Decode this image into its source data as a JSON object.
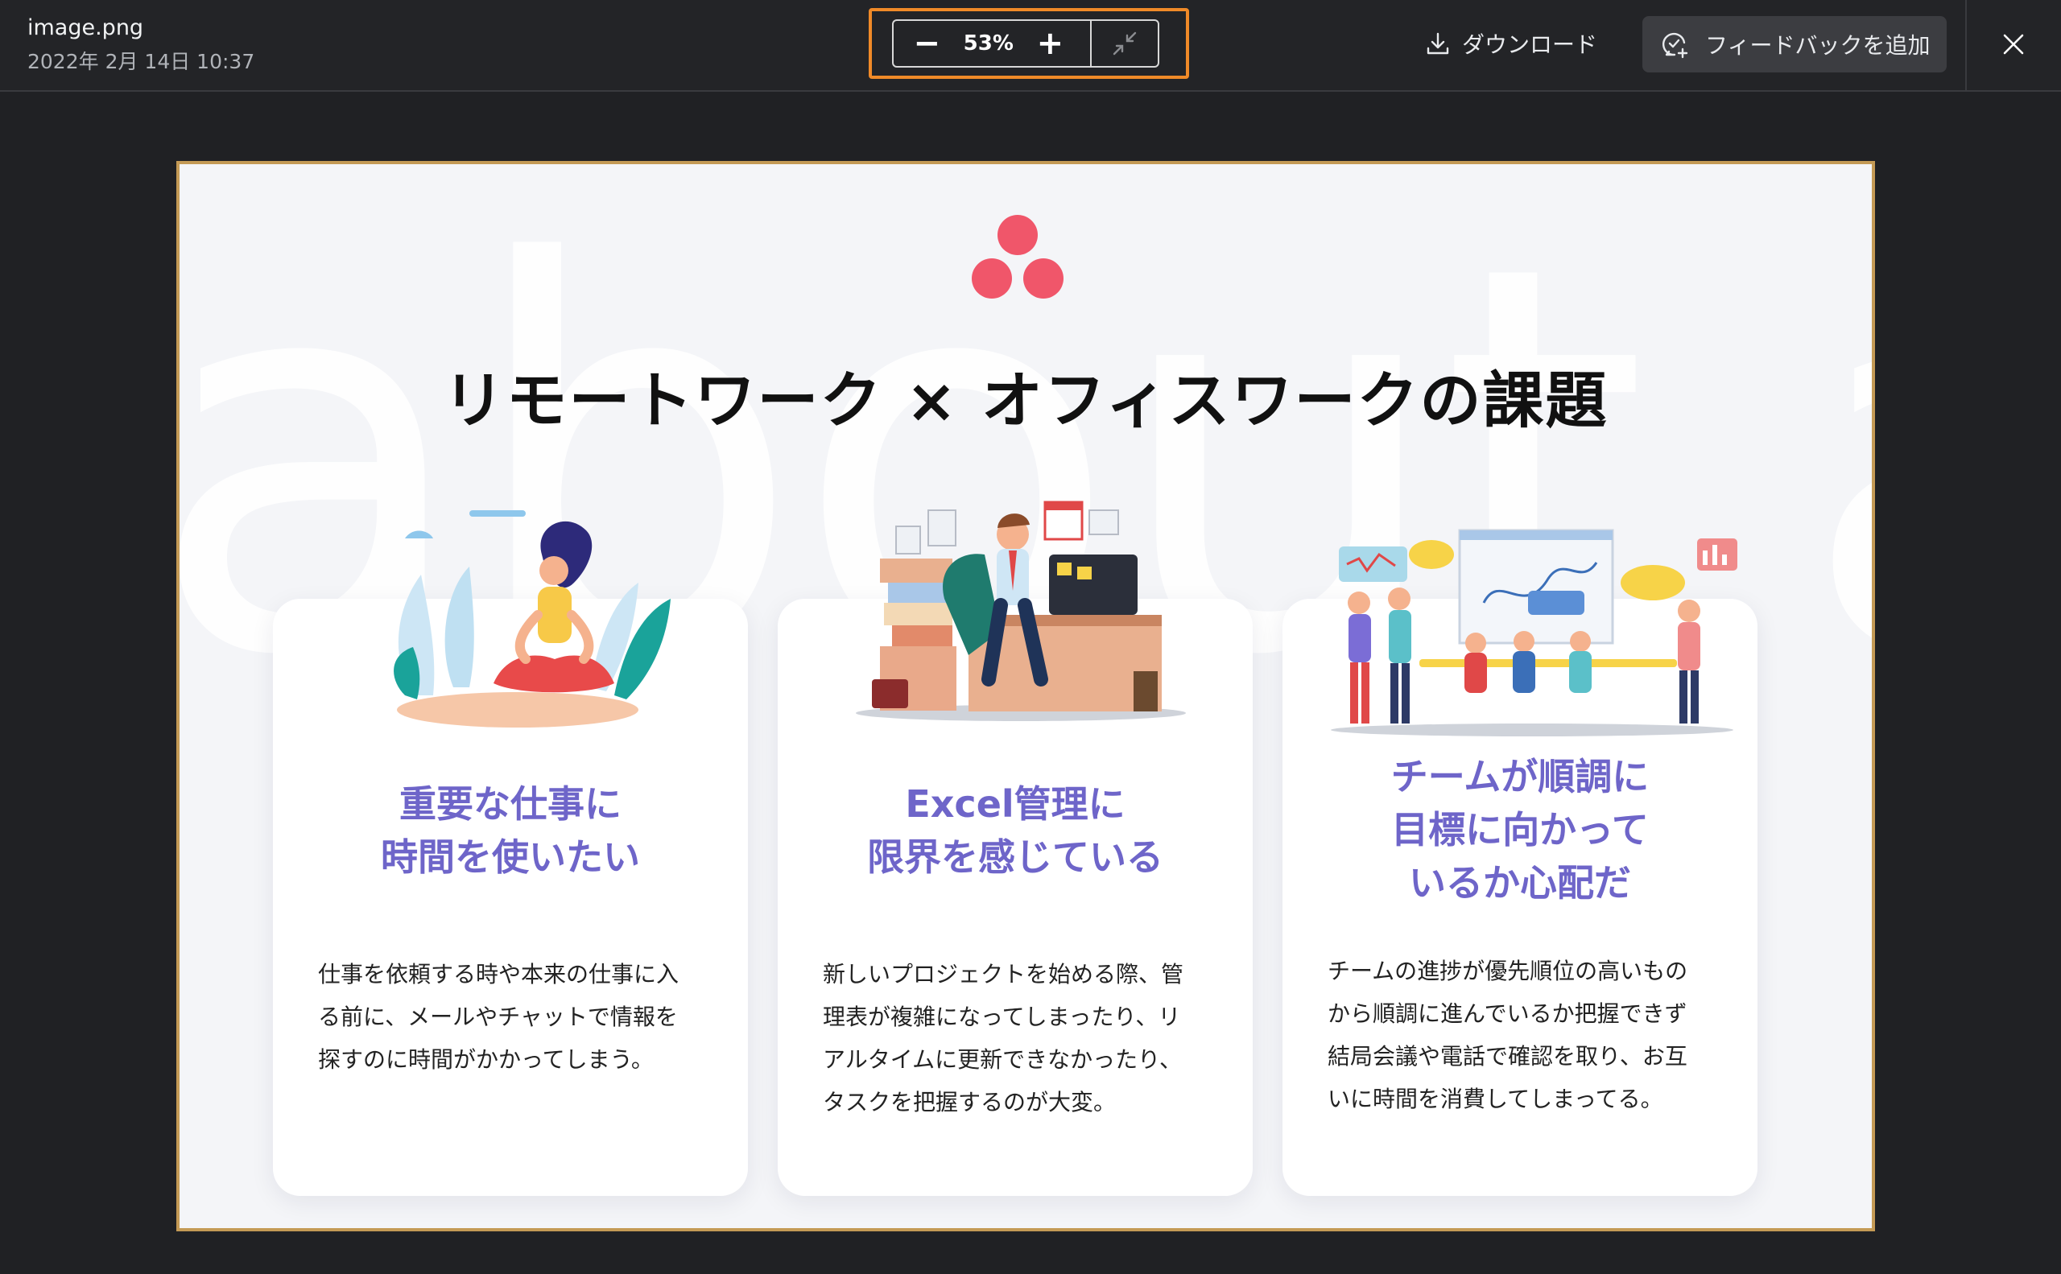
{
  "header": {
    "file_name": "image.png",
    "file_date": "2022年 2月 14日 10:37",
    "zoom": {
      "value": "53%",
      "zoom_out_glyph": "−",
      "zoom_in_glyph": "+"
    },
    "download_label": "ダウンロード",
    "feedback_label": "フィードバックを追加",
    "highlight_color": "#f08a28"
  },
  "slide": {
    "background_word": "about asa",
    "title": "リモートワーク × オフィスワークの課題",
    "accent_color": "#6e65c9",
    "logo_color": "#f0566a",
    "cards": [
      {
        "heading_lines": [
          "重要な仕事に",
          "時間を使いたい"
        ],
        "body_lines": [
          "仕事を依頼する時や本来の仕事に入",
          "る前に、メールやチャットで情報を",
          "探すのに時間がかかってしまう。"
        ]
      },
      {
        "heading_lines": [
          "Excel管理に",
          "限界を感じている"
        ],
        "body_lines": [
          "新しいプロジェクトを始める際、管",
          "理表が複雑になってしまったり、リ",
          "アルタイムに更新できなかったり、",
          "タスクを把握するのが大変。"
        ]
      },
      {
        "heading_lines": [
          "チームが順調に",
          "目標に向かって",
          "いるか心配だ"
        ],
        "body_lines": [
          "チームの進捗が優先順位の高いもの",
          "から順調に進んでいるか把握できず",
          "結局会議や電話で確認を取り、お互",
          "いに時間を消費してしまってる。"
        ]
      }
    ]
  },
  "icons": {
    "download": "download-icon",
    "feedback": "feedback-icon",
    "close": "close-icon",
    "fit": "fit-to-window-icon",
    "logo": "asana-logo-icon"
  }
}
